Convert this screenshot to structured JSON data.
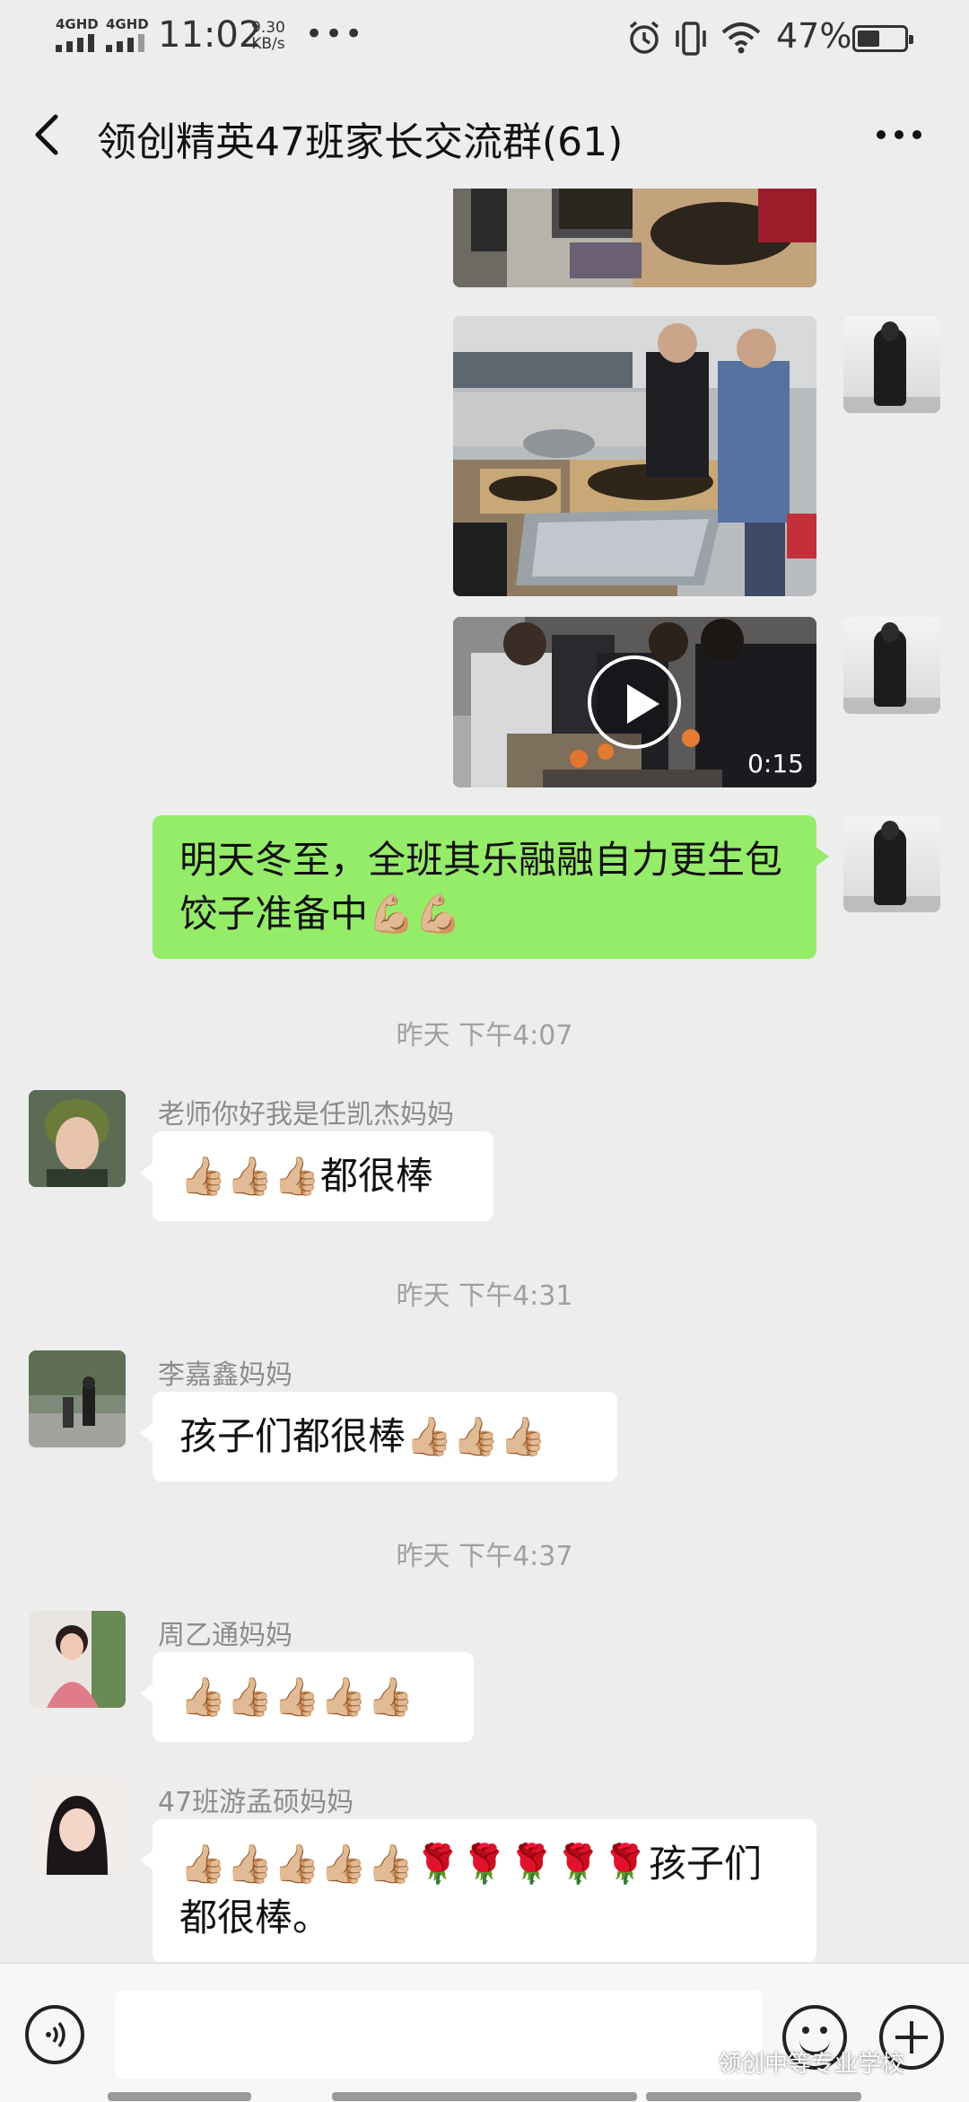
{
  "status_bar": {
    "net1": "4GHD",
    "net2": "4GHD",
    "time": "11:02",
    "speed_value": "9.30",
    "speed_unit": "KB/s",
    "dots": "•••",
    "battery_text": "47%",
    "battery_level": 0.47
  },
  "header": {
    "title": "领创精英47班家长交流群(61)"
  },
  "messages": {
    "video_duration": "0:15",
    "self_text": "明天冬至，全班其乐融融自力更生包饺子准备中💪🏼💪🏼",
    "ts1": "昨天 下午4:07",
    "sender1": "老师你好我是任凯杰妈妈",
    "msg1": "👍🏼👍🏼👍🏼都很棒",
    "ts2": "昨天 下午4:31",
    "sender2": "李嘉鑫妈妈",
    "msg2": "孩子们都很棒👍🏼👍🏼👍🏼",
    "ts3": "昨天 下午4:37",
    "sender3": "周乙通妈妈",
    "msg3": "👍🏼👍🏼👍🏼👍🏼👍🏼",
    "sender4": "47班游孟硕妈妈",
    "msg4": "👍🏼👍🏼👍🏼👍🏼👍🏼🌹🌹🌹🌹🌹孩子们都很棒。"
  },
  "watermark": "领创中等专业学校",
  "colors": {
    "self_bubble": "#95ec69",
    "other_bubble": "#ffffff",
    "background": "#ededed"
  }
}
